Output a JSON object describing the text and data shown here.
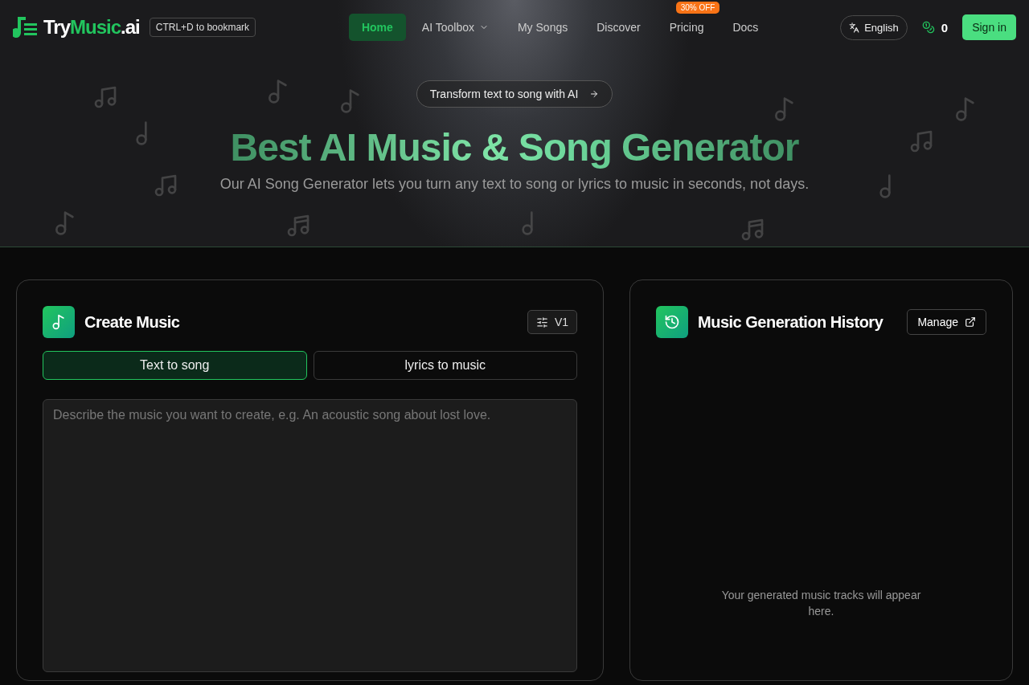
{
  "header": {
    "logo": [
      {
        "text": "Try",
        "kind": "plain"
      },
      {
        "text": "Music",
        "kind": "accent"
      },
      {
        "text": ".ai",
        "kind": "plain"
      }
    ],
    "bookmark_hint": "CTRL+D to bookmark",
    "nav": [
      {
        "label": "Home",
        "selected": true
      },
      {
        "label": "AI Toolbox",
        "selected": false,
        "has_menu": true
      },
      {
        "label": "My Songs",
        "selected": false
      },
      {
        "label": "Discover",
        "selected": false
      },
      {
        "label": "Pricing",
        "selected": false,
        "badge": "30% OFF"
      },
      {
        "label": "Docs",
        "selected": false
      }
    ],
    "language": "English",
    "credits": "0",
    "sign_in": "Sign in"
  },
  "hero": {
    "pill": "Transform text to song with AI",
    "title": "Best AI Music & Song Generator",
    "subtitle": "Our AI Song Generator lets you turn any text to song or lyrics to music in seconds, not days."
  },
  "create_panel": {
    "title": "Create Music",
    "version": "V1",
    "modes": [
      {
        "label": "Text to song",
        "selected": true
      },
      {
        "label": "lyrics to music",
        "selected": false
      }
    ],
    "prompt": {
      "placeholder": "Describe the music you want to create, e.g. An acoustic song about lost love."
    }
  },
  "history_panel": {
    "title": "Music Generation History",
    "manage": "Manage",
    "empty_text": "Your generated music tracks will appear here."
  }
}
